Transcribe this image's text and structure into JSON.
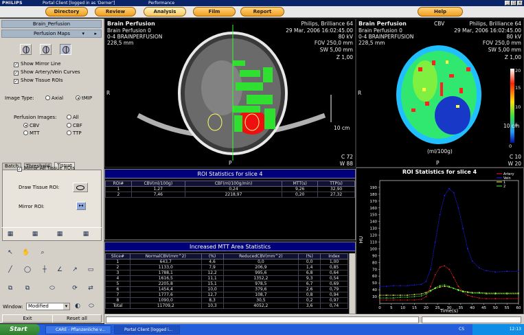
{
  "titlebar": {
    "brand": "PHILIPS",
    "title": "Portal Client [logged in as 'Derner']",
    "performance": "Performance"
  },
  "menu": [
    "Directory",
    "Review",
    "Analysis",
    "Film",
    "Report",
    "Help"
  ],
  "left": {
    "title": "Brain_Perfusion",
    "section": "Perfusion Maps",
    "checks": [
      "Show Mirror Line",
      "Show Artery/Vein Curves",
      "Show Tissue ROIs"
    ],
    "image_type_label": "Image Type:",
    "image_type": [
      "Axial",
      "tMIP"
    ],
    "perfusion_label": "Perfusion Images:",
    "perfusion": [
      "All",
      "CBV",
      "CBF",
      "MTT",
      "TTP"
    ],
    "tabs": [
      "Batch",
      "Threshold",
      "Tissue"
    ],
    "mirror_all": "Mirror All Tissue ROIs",
    "draw_roi": "Draw Tissue ROI:",
    "mirror_roi": "Mirror ROI:",
    "window_label": "Window:",
    "window_value": "Modified",
    "exit": "Exit",
    "reset": "Reset all"
  },
  "viewer1": {
    "title": "Brain Perfusion",
    "sub1": "Brain Perfusion 0",
    "sub2": "0-4 BRAINPERFUSION",
    "sub3": "228,5 mm",
    "r1": "Philips, Brilliance 64",
    "r2": "29 Mar, 2006 16:02:45.00",
    "r3": "80 kV",
    "r4": "FOV 250,0 mm",
    "r5": "SW 5,00 mm",
    "r6": "Z 1,00",
    "scale": "10 cm",
    "c": "C    72",
    "w": "W    88",
    "left": "R",
    "bottom": "P"
  },
  "viewer2": {
    "title": "Brain Perfusion",
    "tag": "CBV",
    "sub1": "Brain Perfusion 0",
    "sub2": "0-4 BRAINPERFUSION",
    "sub3": "228,5 mm",
    "r1": "Philips, Brilliance 64",
    "r2": "29 Mar, 2006 16:02:45.00",
    "r3": "80 kV",
    "r4": "FOV 250,0 mm",
    "r5": "SW 5,00 mm",
    "r6": "Z 1,00",
    "scale": "10 cm",
    "unit": "(ml/100g)",
    "c": "C    10",
    "w": "W    20",
    "left": "R",
    "bottom": "P",
    "colorbar": [
      "20",
      "15",
      "10",
      "5",
      "0"
    ]
  },
  "roi_table": {
    "title": "ROI Statistics for slice 4",
    "headers": [
      "ROI#",
      "CBV(ml/100g)",
      "CBF(ml/100g/min)",
      "MTT(s)",
      "TTP(s)"
    ],
    "rows": [
      [
        "1",
        "1,27",
        "0,24",
        "9,26",
        "32,90"
      ],
      [
        "2",
        "7,46",
        "2218,97",
        "0,20",
        "27,32"
      ]
    ]
  },
  "mtt_table": {
    "title": "Increased MTT Area Statistics",
    "headers": [
      "Slice#",
      "NormalCBV(mm^2)",
      "(%)",
      "ReducedCBV(mm^2)",
      "(%)",
      "Index"
    ],
    "rows": [
      [
        "1",
        "643,7",
        "4,6",
        "0,0",
        "0,0",
        "1,00"
      ],
      [
        "2",
        "1133,0",
        "7,9",
        "206,9",
        "1,4",
        "0,85"
      ],
      [
        "3",
        "1788,1",
        "12,2",
        "995,6",
        "6,8",
        "0,64"
      ],
      [
        "4",
        "1616,5",
        "11,1",
        "1352,2",
        "9,3",
        "0,54"
      ],
      [
        "5",
        "2205,8",
        "15,1",
        "978,5",
        "6,7",
        "0,69"
      ],
      [
        "6",
        "1454,4",
        "10,0",
        "379,6",
        "2,6",
        "0,79"
      ],
      [
        "7",
        "1777,6",
        "12,7",
        "108,7",
        "0,8",
        "0,94"
      ],
      [
        "8",
        "1090,0",
        "8,3",
        "30,5",
        "0,2",
        "0,97"
      ],
      [
        "Total",
        "11709,2",
        "10,3",
        "4052,2",
        "3,6",
        "0,74"
      ]
    ]
  },
  "chart_data": {
    "type": "line",
    "title": "ROI Statistics for slice 4",
    "xlabel": "Time(s)",
    "ylabel": "HU",
    "xlim": [
      0,
      60
    ],
    "ylim": [
      20,
      200
    ],
    "xticks": [
      0,
      5,
      10,
      15,
      20,
      25,
      30,
      35,
      40,
      45,
      50,
      55,
      60
    ],
    "yticks": [
      30,
      40,
      50,
      60,
      70,
      80,
      90,
      100,
      110,
      120,
      130,
      140,
      150,
      160,
      170,
      180,
      190
    ],
    "legend_position": "top-right",
    "x": [
      0,
      3,
      6,
      9,
      12,
      15,
      18,
      20,
      22,
      24,
      26,
      28,
      30,
      32,
      34,
      36,
      38,
      40,
      43,
      46,
      50,
      55,
      60
    ],
    "series": [
      {
        "name": "Artery",
        "color": "#ff2020",
        "values": [
          25,
          25,
          25,
          25,
          25,
          25,
          26,
          30,
          45,
          62,
          73,
          75,
          70,
          58,
          45,
          37,
          32,
          30,
          28,
          27,
          27,
          27,
          27
        ]
      },
      {
        "name": "Vein",
        "color": "#2020ff",
        "values": [
          45,
          45,
          46,
          46,
          46,
          47,
          48,
          52,
          70,
          110,
          150,
          178,
          188,
          182,
          160,
          130,
          100,
          82,
          72,
          68,
          66,
          67,
          67
        ]
      },
      {
        "name": "1",
        "color": "#ffff40",
        "values": [
          32,
          32,
          32,
          32,
          32,
          33,
          34,
          36,
          39,
          42,
          44,
          45,
          44,
          42,
          40,
          38,
          37,
          36,
          36,
          35,
          35,
          35,
          35
        ]
      },
      {
        "name": "2",
        "color": "#40ff40",
        "values": [
          28,
          28,
          28,
          29,
          29,
          30,
          31,
          34,
          38,
          43,
          46,
          47,
          45,
          42,
          39,
          37,
          36,
          35,
          35,
          34,
          34,
          34,
          34
        ]
      }
    ]
  },
  "taskbar": {
    "start": "Start",
    "task1": "CARE - Pflanzenliche v...",
    "task2": "Portal Client [logged i...",
    "time": "12:13",
    "lang": "CS"
  }
}
